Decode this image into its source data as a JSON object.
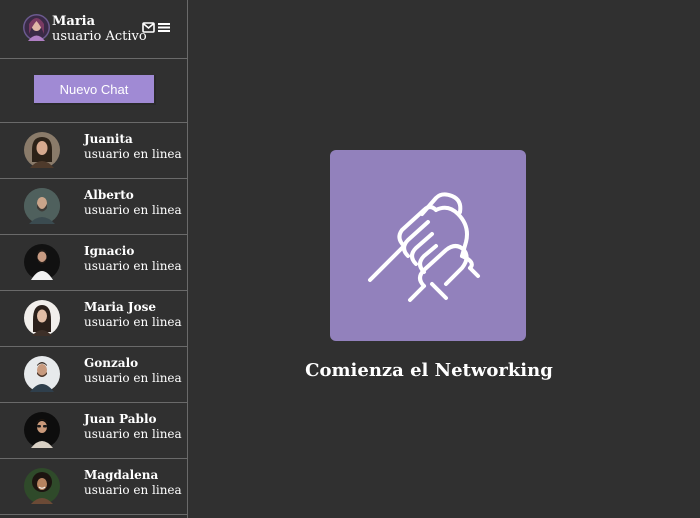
{
  "colors": {
    "background": "#303030",
    "accent": "#a08ad4",
    "hero": "#9281bc",
    "divider": "#6a6a6a"
  },
  "current_user": {
    "name": "Maria",
    "status": "usuario Activo",
    "icons": [
      "envelope-icon",
      "menu-icon"
    ]
  },
  "sidebar": {
    "new_chat_label": "Nuevo Chat",
    "contacts": [
      {
        "name": "Juanita",
        "status": "usuario en linea"
      },
      {
        "name": "Alberto",
        "status": "usuario en linea"
      },
      {
        "name": "Ignacio",
        "status": "usuario en linea"
      },
      {
        "name": "Maria Jose",
        "status": "usuario en linea"
      },
      {
        "name": "Gonzalo",
        "status": "usuario en linea"
      },
      {
        "name": "Juan Pablo",
        "status": "usuario en linea"
      },
      {
        "name": "Magdalena",
        "status": "usuario en linea"
      }
    ]
  },
  "main": {
    "hero_icon": "handshake-icon",
    "title": "Comienza el Networking"
  }
}
